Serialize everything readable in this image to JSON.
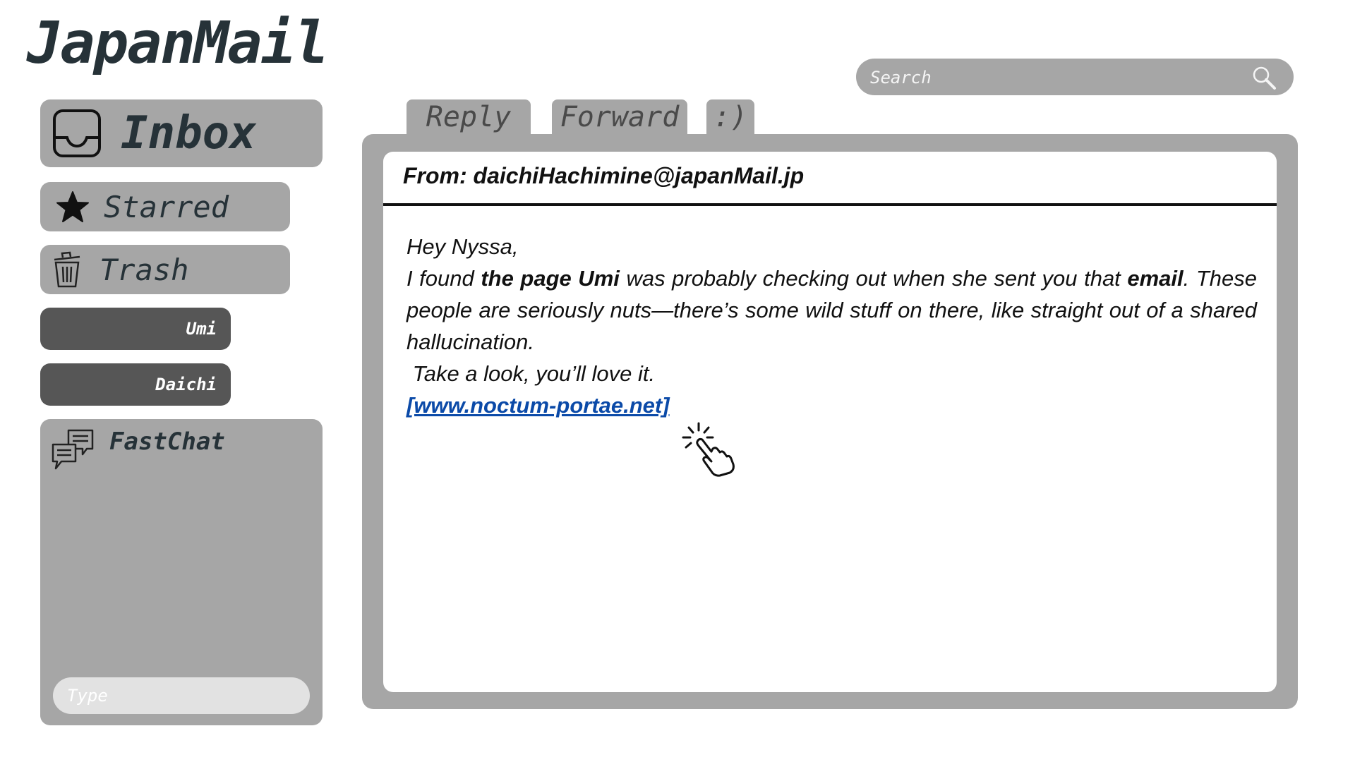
{
  "app": {
    "title": "JapanMail"
  },
  "search": {
    "placeholder": "Search"
  },
  "sidebar": {
    "items": [
      {
        "label": "Inbox",
        "icon": "inbox-tray-icon"
      },
      {
        "label": "Starred",
        "icon": "star-icon"
      },
      {
        "label": "Trash",
        "icon": "trash-icon"
      }
    ],
    "contacts": [
      {
        "label": "Umi"
      },
      {
        "label": "Daichi"
      }
    ]
  },
  "fastchat": {
    "title": "FastChat",
    "icon": "chat-bubbles-icon",
    "input_placeholder": "Type"
  },
  "toolbar": {
    "reply_label": "Reply",
    "forward_label": "Forward",
    "emoji_label": ":)"
  },
  "email": {
    "from": "From: daichiHachimine@japanMail.jp",
    "greeting": "Hey Nyssa,",
    "p1_a": "I found ",
    "p1_bold1": "the page Umi",
    "p1_b": " was probably checking out when she sent you that ",
    "p1_bold2": "email",
    "p1_c": ". These people are seriously nuts—there’s some wild stuff on there, like straight out of a shared hallucination.",
    "line2": "Take a look, you’ll love it.",
    "link": "[www.noctum-portae.net]"
  },
  "colors": {
    "panel_gray": "#a6a6a6",
    "contact_dark": "#565656",
    "text_dark": "#263238",
    "link_blue": "#0b4aa8"
  }
}
